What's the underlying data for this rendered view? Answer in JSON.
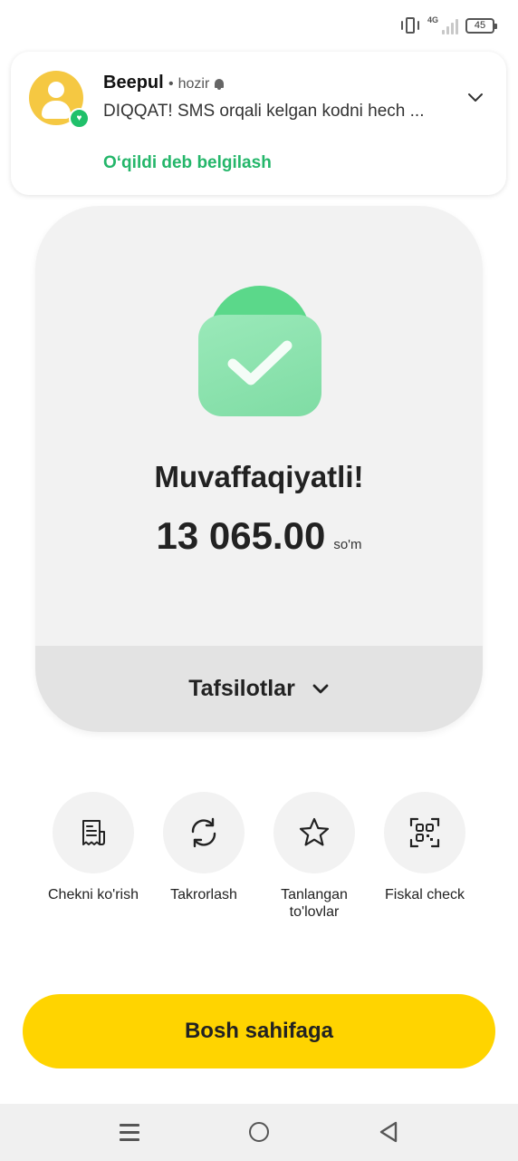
{
  "status_bar": {
    "network": "4G",
    "battery": "45"
  },
  "notification": {
    "app_name": "Beepul",
    "time": "hozir",
    "body": "DIQQAT! SMS orqali kelgan kodni hech ...",
    "action_label": "O‘qildi deb belgilash",
    "accent_color": "#24b66a"
  },
  "result": {
    "title": "Muvaffaqiyatli!",
    "amount": "13 065.00",
    "currency": "so'm",
    "details_label": "Tafsilotlar"
  },
  "actions": [
    {
      "label": "Chekni ko'rish",
      "icon": "receipt-icon"
    },
    {
      "label": "Takrorlash",
      "icon": "repeat-icon"
    },
    {
      "label": "Tanlangan to'lovlar",
      "icon": "star-icon"
    },
    {
      "label": "Fiskal check",
      "icon": "qr-code-icon"
    }
  ],
  "primary_button": {
    "label": "Bosh sahifaga",
    "color": "#ffd400"
  },
  "nav_bar": {
    "icons": [
      "menu-icon",
      "home-icon",
      "back-icon"
    ]
  }
}
